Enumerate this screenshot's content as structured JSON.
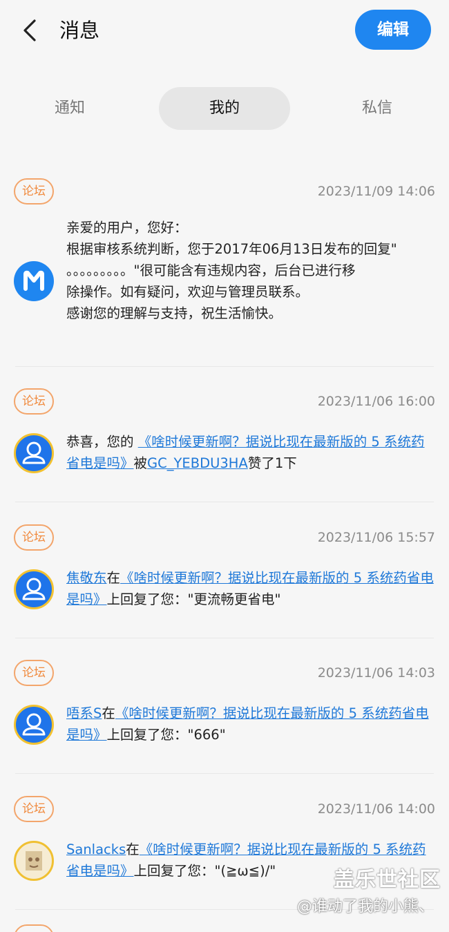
{
  "header": {
    "title": "消息",
    "edit_label": "编辑"
  },
  "tabs": [
    {
      "label": "通知"
    },
    {
      "label": "我的",
      "selected": true
    },
    {
      "label": "私信"
    }
  ],
  "messages": [
    {
      "badge": "论坛",
      "time": "2023/11/09 14:06",
      "avatar": "system-m-icon",
      "lines": [
        "亲爱的用户，您好：",
        "根据审核系统判断，您于2017年06月13日发布的回复\"",
        "。。。。。。。。。\"很可能含有违规内容，后台已进行移",
        "除操作。如有疑问，欢迎与管理员联系。",
        "感谢您的理解与支持，祝生活愉快。"
      ]
    },
    {
      "badge": "论坛",
      "time": "2023/11/06 16:00",
      "avatar": "user-icon",
      "prefix": "恭喜，您的 ",
      "thread": "《啥时候更新啊？据说比现在最新版的 5 系统药省电是吗》",
      "mid": "被",
      "user": "GC_YEBDU3HA",
      "suffix": "赞了1下"
    },
    {
      "badge": "论坛",
      "time": "2023/11/06 15:57",
      "avatar": "user-icon",
      "user": "焦敬东",
      "mid": "在",
      "thread": "《啥时候更新啊？据说比现在最新版的 5 系统药省电是吗》",
      "suffix": "上回复了您：\"更流畅更省电\""
    },
    {
      "badge": "论坛",
      "time": "2023/11/06 14:03",
      "avatar": "user-icon",
      "user": "唔系S",
      "mid": "在",
      "thread": "《啥时候更新啊？据说比现在最新版的 5 系统药省电是吗》",
      "suffix": "上回复了您：\"666\""
    },
    {
      "badge": "论坛",
      "time": "2023/11/06 14:00",
      "avatar": "photo-avatar",
      "user": "Sanlacks",
      "mid": "在",
      "thread": "《啥时候更新啊？据说比现在最新版的 5 系统药省电是吗》",
      "suffix": "上回复了您：\"(≧ω≦)/\""
    }
  ],
  "watermark": {
    "site": "盖乐世社区",
    "author": "@谁动了我的小熊、"
  },
  "colors": {
    "accent": "#1f86f0",
    "badge": "#f08a3e",
    "link": "#1e78d8"
  }
}
